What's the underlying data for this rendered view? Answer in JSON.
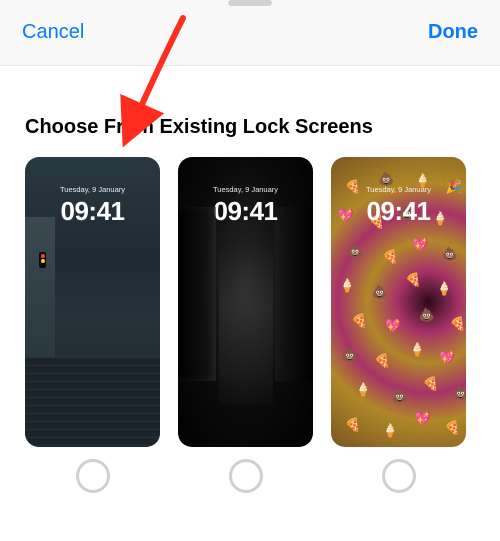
{
  "topbar": {
    "cancel_label": "Cancel",
    "done_label": "Done"
  },
  "section": {
    "title": "Choose From Existing Lock Screens"
  },
  "screens": [
    {
      "date": "Tuesday, 9 January",
      "time": "09:41"
    },
    {
      "date": "Tuesday, 9 January",
      "time": "09:41"
    },
    {
      "date": "Tuesday, 9 January",
      "time": "09:41"
    }
  ],
  "colors": {
    "accent": "#0a7aff",
    "arrow": "#ff2d1f"
  },
  "annotation": {
    "arrow_target": "first-lock-screen"
  }
}
